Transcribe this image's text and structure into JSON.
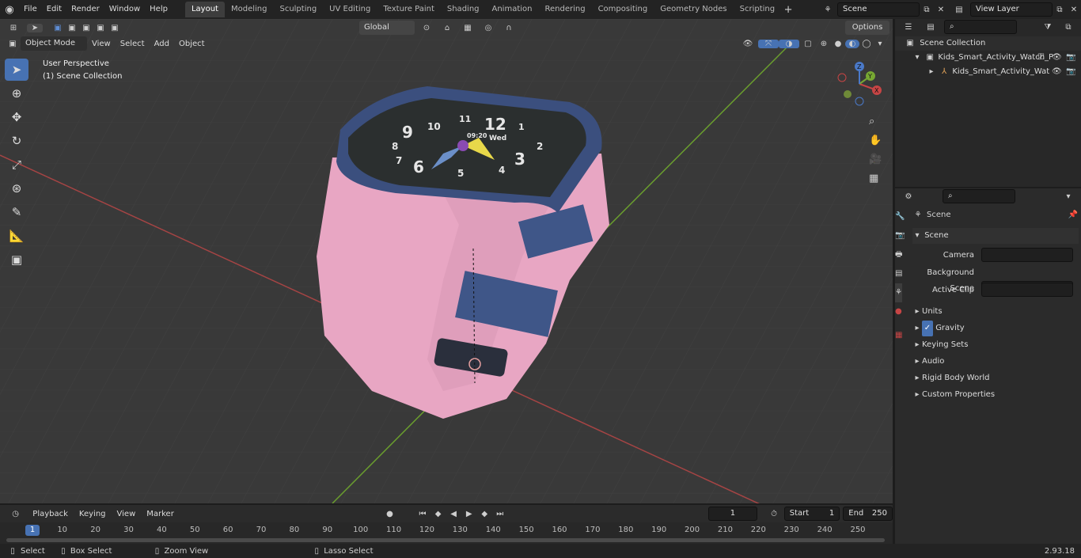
{
  "app": {
    "version": "2.93.18"
  },
  "topbar": {
    "menus": [
      "File",
      "Edit",
      "Render",
      "Window",
      "Help"
    ],
    "workspaces": [
      "Layout",
      "Modeling",
      "Sculpting",
      "UV Editing",
      "Texture Paint",
      "Shading",
      "Animation",
      "Rendering",
      "Compositing",
      "Geometry Nodes",
      "Scripting"
    ],
    "active_workspace": "Layout",
    "scene_name": "Scene",
    "view_layer": "View Layer"
  },
  "viewport_toolbar": {
    "transform_orientation": "Global",
    "options_label": "Options"
  },
  "viewport_header": {
    "mode": "Object Mode",
    "menus": [
      "View",
      "Select",
      "Add",
      "Object"
    ]
  },
  "viewport": {
    "perspective_label": "User Perspective",
    "collection_label": "(1) Scene Collection",
    "watch_numbers": [
      "12",
      "11",
      "1",
      "10",
      "2",
      "9",
      "3",
      "8",
      "4",
      "7",
      "5",
      "6"
    ],
    "watch_weekday": "Wed",
    "watch_time": "09:20"
  },
  "outliner": {
    "search_placeholder": "",
    "root": "Scene Collection",
    "items": [
      {
        "label": "Kids_Smart_Activity_Watch_P"
      },
      {
        "label": "Kids_Smart_Activity_Wat"
      }
    ]
  },
  "properties": {
    "context_title": "Scene",
    "panel_title": "Scene",
    "fields": [
      {
        "label": "Camera",
        "value": ""
      },
      {
        "label": "Background Scene",
        "value": ""
      },
      {
        "label": "Active Clip",
        "value": ""
      }
    ],
    "sections": [
      {
        "label": "Units"
      },
      {
        "label": "Gravity",
        "checked": true
      },
      {
        "label": "Keying Sets"
      },
      {
        "label": "Audio"
      },
      {
        "label": "Rigid Body World"
      },
      {
        "label": "Custom Properties"
      }
    ]
  },
  "timeline": {
    "menus": [
      "Playback",
      "Keying",
      "View",
      "Marker"
    ],
    "current_frame": "1",
    "start_label": "Start",
    "start_value": "1",
    "end_label": "End",
    "end_value": "250",
    "ticks": [
      "1",
      "10",
      "20",
      "30",
      "40",
      "50",
      "60",
      "70",
      "80",
      "90",
      "100",
      "110",
      "120",
      "130",
      "140",
      "150",
      "160",
      "170",
      "180",
      "190",
      "200",
      "210",
      "220",
      "230",
      "240",
      "250"
    ]
  },
  "statusbar": {
    "items": [
      "Select",
      "Box Select",
      "Zoom View",
      "Lasso Select"
    ]
  },
  "colors": {
    "accent": "#4772b3",
    "watch_pink": "#e8a6c3",
    "watch_blue": "#3f5688",
    "axis_red": "#c74545",
    "axis_green": "#77a832"
  }
}
